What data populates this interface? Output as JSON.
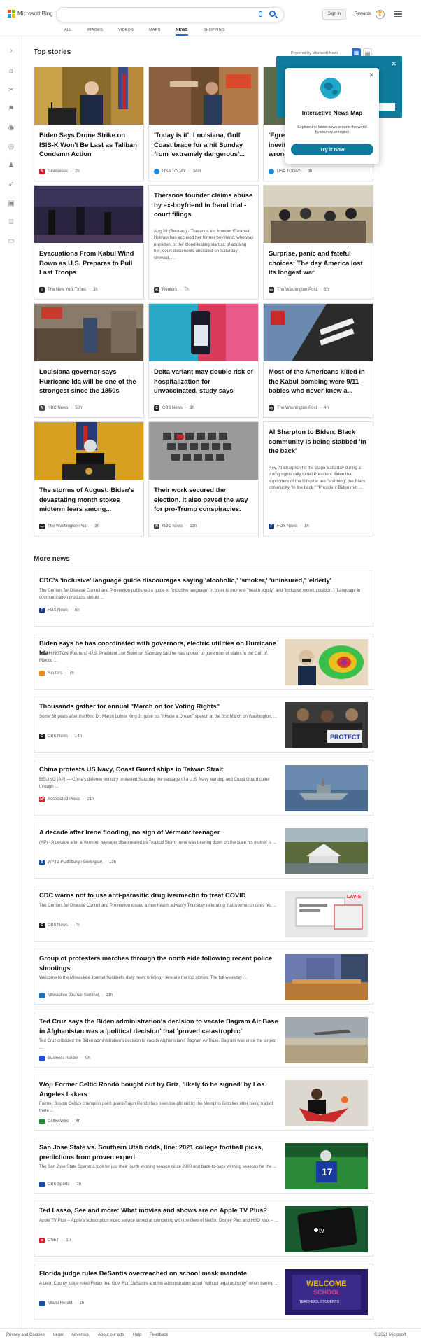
{
  "brand": {
    "name": "Microsoft Bing"
  },
  "header": {
    "signin_label": "Sign in",
    "rewards_label": "Rewards"
  },
  "tabs": [
    {
      "label": "ALL"
    },
    {
      "label": "IMAGES"
    },
    {
      "label": "VIDEOS"
    },
    {
      "label": "MAPS"
    },
    {
      "label": "NEWS",
      "active": true
    },
    {
      "label": "SHOPPING"
    }
  ],
  "top_stories": {
    "heading": "Top stories",
    "powered": "Powered by Microsoft News",
    "cards": [
      {
        "title": "Biden Says Drone Strike on ISIS-K Won't Be Last as Taliban Condemn Action",
        "source": "Newsweek",
        "time": "2h",
        "icon_color": "#d81e2a",
        "icon_letter": "N"
      },
      {
        "title": "'Today is it': Louisiana, Gulf Coast brace for a hit Sunday from 'extremely dangerous'...",
        "source": "USA TODAY",
        "time": "34m",
        "icon_color": "#1a8de0",
        "icon_letter": ""
      },
      {
        "title": "'Egregious... inevitable... wrong...",
        "source": "USA TODAY",
        "time": "3h",
        "icon_color": "#1a8de0",
        "icon_letter": ""
      },
      {
        "title": "Evacuations From Kabul Wind Down as U.S. Prepares to Pull Last Troops",
        "source": "The New York Times",
        "time": "3h",
        "icon_color": "#222222",
        "icon_letter": "T"
      },
      {
        "title": "Theranos founder claims abuse by ex-boyfriend in fraud trial - court filings",
        "snippet": "Aug 28 (Reuters) - Theranos Inc founder Elizabeth Holmes has accused her former boyfriend, who was president of the blood-testing startup, of abusing her, court documents unsealed on Saturday showed, ...",
        "source": "Reuters",
        "time": "7h",
        "icon_color": "#333333",
        "icon_letter": "R"
      },
      {
        "title": "Surprise, panic and fateful choices: The day America lost its longest war",
        "source": "The Washington Post",
        "time": "6h",
        "icon_color": "#222222",
        "icon_letter": "wp"
      },
      {
        "title": "Louisiana governor says Hurricane Ida will be one of the strongest since the 1850s",
        "source": "NBC News",
        "time": "50m",
        "icon_color": "#444444",
        "icon_letter": "N"
      },
      {
        "title": "Delta variant may double risk of hospitalization for unvaccinated, study says",
        "source": "CBS News",
        "time": "3h",
        "icon_color": "#222222",
        "icon_letter": "C"
      },
      {
        "title": "Most of the Americans killed in the Kabul bombing were 9/11 babies who never knew a...",
        "source": "The Washington Post",
        "time": "4h",
        "icon_color": "#222222",
        "icon_letter": "wp"
      },
      {
        "title": "The storms of August: Biden's devastating month stokes midterm fears among...",
        "source": "The Washington Post",
        "time": "3h",
        "icon_color": "#222222",
        "icon_letter": "wp"
      },
      {
        "title": "Their work secured the election. It also paved the way for pro-Trump conspiracies.",
        "source": "NBC News",
        "time": "13h",
        "icon_color": "#444444",
        "icon_letter": "N"
      },
      {
        "title": "Al Sharpton to Biden: Black community is being stabbed 'in the back'",
        "snippet": "Rev. Al Sharpton hit the stage Saturday during a voting rights rally to tell President Biden that supporters of the filibuster are \"stabbing\" the Black community \"in the back.\" \"President Biden met ...",
        "source": "FOX News",
        "time": "1h",
        "icon_color": "#1a3a7a",
        "icon_letter": "F"
      }
    ]
  },
  "map_popup": {
    "title": "Interactive News Map",
    "description": "Explore the latest news around the world by country or region",
    "button": "Try it now"
  },
  "more_news": {
    "heading": "More news",
    "items": [
      {
        "title": "CDC's 'inclusive' language guide discourages saying 'alcoholic,' 'smoker,' 'uninsured,' 'elderly'",
        "snippet": "The Centers for Disease Control and Prevention published a guide to \"inclusive language\" in order to promote \"health equity\" and \"inclusive communication.\" \"Language in communication products should ...",
        "source": "FOX News",
        "time": "5h",
        "icon_color": "#1a3a7a",
        "icon_letter": "F"
      },
      {
        "title": "Biden says he has coordinated with governors, electric utilities on Hurricane Ida",
        "snippet": "WASHINGTON (Reuters) -U.S. President Joe Biden on Saturday said he has spoken to governors of states in the Gulf of Mexico ...",
        "source": "Reuters",
        "time": "7h",
        "icon_color": "#f08a24",
        "icon_letter": ""
      },
      {
        "title": "Thousands gather for annual \"March on for Voting Rights\"",
        "snippet": "Some 58 years after the Rev. Dr. Martin Luther King Jr. gave his \"I Have a Dream\" speech at the first March on Washington, ...",
        "source": "CBS News",
        "time": "14h",
        "icon_color": "#222222",
        "icon_letter": "C"
      },
      {
        "title": "China protests US Navy, Coast Guard ships in Taiwan Strait",
        "snippet": "BEIJING (AP) — China's defense ministry protested Saturday the passage of a U.S. Navy warship and Coast Guard cutter through ...",
        "source": "Associated Press",
        "time": "21h",
        "icon_color": "#d81e2a",
        "icon_letter": "AP"
      },
      {
        "title": "A decade after Irene flooding, no sign of Vermont teenager",
        "snippet": "(AP) - A decade after a Vermont teenager disappeared as Tropical Storm Irene was bearing down on the state his mother is ...",
        "source": "WPTZ Plattsburgh-Burlington",
        "time": "13h",
        "icon_color": "#1a4fa0",
        "icon_letter": "5"
      },
      {
        "title": "CDC warns not to use anti-parasitic drug ivermectin to treat COVID",
        "snippet": "The Centers for Disease Control and Prevention issued a new health advisory Thursday reiterating that ivermectin does not ...",
        "source": "CBS News",
        "time": "7h",
        "icon_color": "#222222",
        "icon_letter": "C"
      },
      {
        "title": "Group of protesters marches through the north side following recent police shootings",
        "snippet": "Welcome to the Milwaukee Journal Sentinel's daily news briefing. Here are the top stories. The full weekday ...",
        "source": "Milwaukee Journal-Sentinel",
        "time": "21h",
        "icon_color": "#1a6fc0",
        "icon_letter": ""
      },
      {
        "title": "Ted Cruz says the Biden administration's decision to vacate Bagram Air Base in Afghanistan was a 'political decision' that 'proved catastrophic'",
        "snippet": "Ted Cruz criticized the Biden administration's decision to vacate Afghanistan's Bagram Air Base. Bagram was once the largest ...",
        "source": "Business Insider",
        "time": "9h",
        "icon_color": "#1e4fd9",
        "icon_letter": ""
      },
      {
        "title": "Woj: Former Celtic Rondo bought out by Griz, 'likely to be signed' by Los Angeles Lakers",
        "snippet": "Former Boston Celtics champion point guard Rajon Rondo has been bought out by the Memphis Grizzlies after being traded there ...",
        "source": "CelticsWire",
        "time": "4h",
        "icon_color": "#2a8a3a",
        "icon_letter": ""
      },
      {
        "title": "San Jose State vs. Southern Utah odds, line: 2021 college football picks, predictions from proven expert",
        "snippet": "The San Jose State Spartans look for just their fourth winning season since 2000 and back-to-back winning seasons for the ...",
        "source": "CBS Sports",
        "time": "1h",
        "icon_color": "#1a4fa0",
        "icon_letter": ""
      },
      {
        "title": "Ted Lasso, See and more: What movies and shows are on Apple TV Plus?",
        "snippet": "Apple TV Plus -- Apple's subscription video service aimed at competing with the likes of Netflix, Disney Plus and HBO Max -- ...",
        "source": "CNET",
        "time": "1h",
        "icon_color": "#d81e2a",
        "icon_letter": "c"
      },
      {
        "title": "Florida judge rules DeSantis overreached on school mask mandate",
        "snippet": "A Leon County judge ruled Friday that Gov. Ron DeSantis and his administration acted \"without legal authority\" when barring ...",
        "source": "Miami Herald",
        "time": "1h",
        "icon_color": "#1a4fa0",
        "icon_letter": ""
      }
    ]
  },
  "footer": {
    "links": [
      "Privacy and Cookies",
      "Legal",
      "Advertise",
      "About our ads",
      "Help",
      "Feedback"
    ],
    "copyright": "© 2021 Microsoft"
  }
}
